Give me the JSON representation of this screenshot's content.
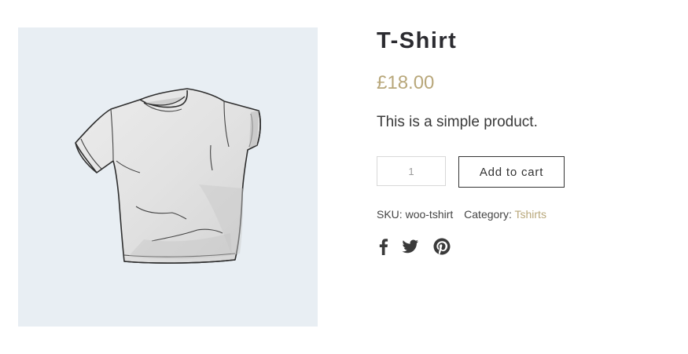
{
  "product": {
    "title": "T-Shirt",
    "price": "£18.00",
    "description": "This is a simple product.",
    "quantity_value": "1",
    "add_to_cart_label": "Add to cart",
    "sku_label": "SKU:",
    "sku_value": "woo-tshirt",
    "category_label": "Category:",
    "category_value": "Tshirts"
  },
  "social": {
    "icons": [
      "facebook-icon",
      "twitter-icon",
      "pinterest-icon"
    ]
  },
  "colors": {
    "accent": "#b8a77a",
    "text": "#2b2b30",
    "image_background": "#e8eef3"
  }
}
